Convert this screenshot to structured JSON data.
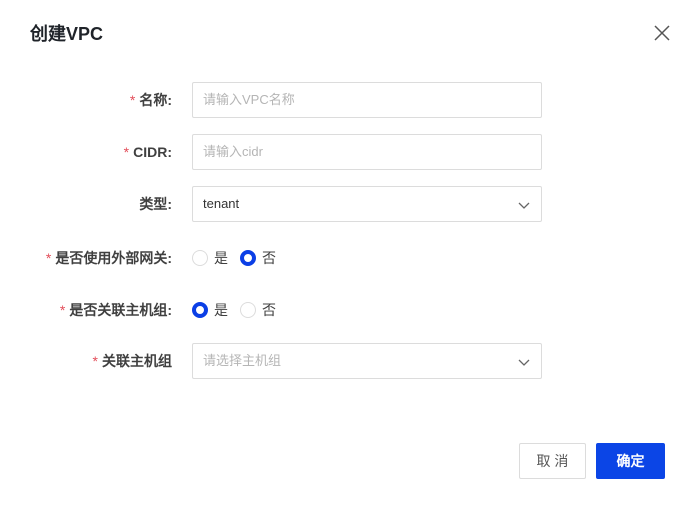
{
  "dialog": {
    "title": "创建VPC"
  },
  "form": {
    "name": {
      "required_mark": "*",
      "label": "名称:",
      "placeholder": "请输入VPC名称"
    },
    "cidr": {
      "required_mark": "*",
      "label": "CIDR:",
      "placeholder": "请输入cidr"
    },
    "type": {
      "label": "类型:",
      "value": "tenant"
    },
    "external_gateway": {
      "required_mark": "*",
      "label": "是否使用外部网关:",
      "options": [
        {
          "label": "是",
          "checked": false
        },
        {
          "label": "否",
          "checked": true
        }
      ]
    },
    "assoc_host_group": {
      "required_mark": "*",
      "label": "是否关联主机组:",
      "options": [
        {
          "label": "是",
          "checked": true
        },
        {
          "label": "否",
          "checked": false
        }
      ]
    },
    "host_group": {
      "required_mark": "*",
      "label": "关联主机组",
      "placeholder": "请选择主机组"
    }
  },
  "footer": {
    "cancel_label": "取 消",
    "ok_label": "确定"
  },
  "colors": {
    "primary": "#0b45e6",
    "required": "#e34d59"
  }
}
